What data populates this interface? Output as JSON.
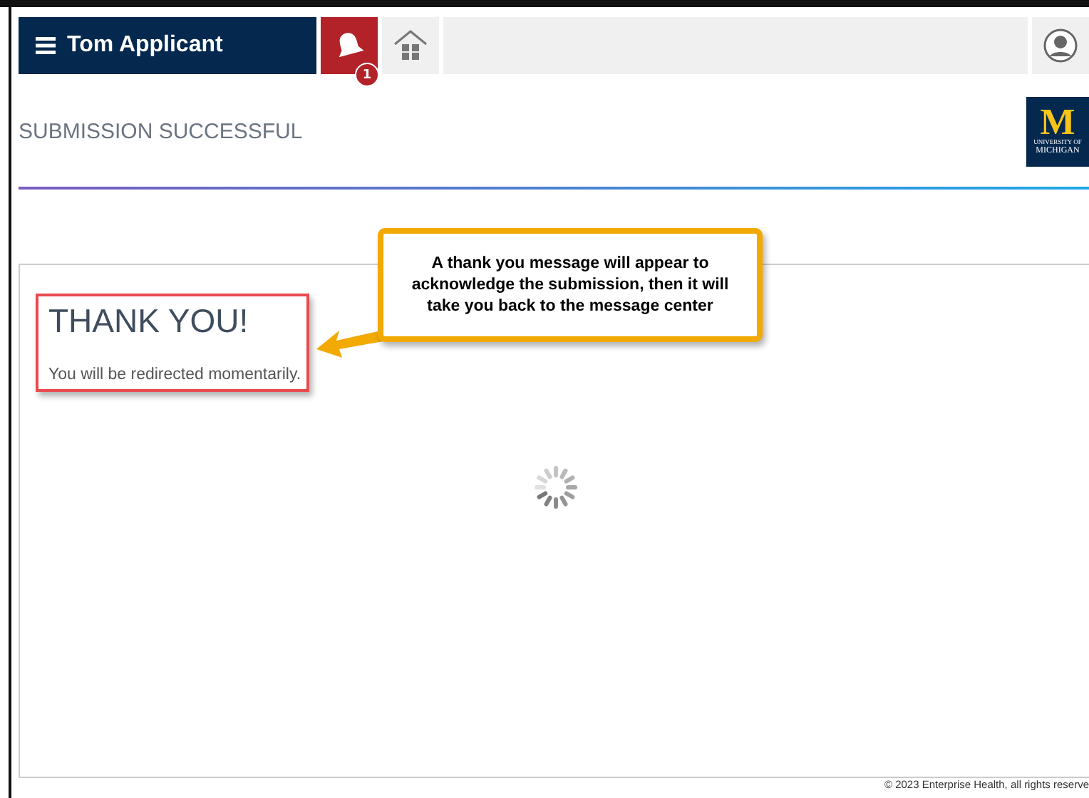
{
  "nav": {
    "user_name": "Tom Applicant",
    "notification_count": "1"
  },
  "header": {
    "title": "SUBMISSION SUCCESSFUL",
    "logo": {
      "letter": "M",
      "line_1": "UNIVERSITY OF",
      "line_2": "MICHIGAN"
    }
  },
  "content": {
    "heading": "THANK YOU!",
    "message": "You will be redirected momentarily."
  },
  "callout": {
    "text": "A thank you message will appear to acknowledge the submission, then it will take you back to the message center"
  },
  "footer": {
    "copyright": "© 2023 Enterprise Health, all rights reserve"
  }
}
